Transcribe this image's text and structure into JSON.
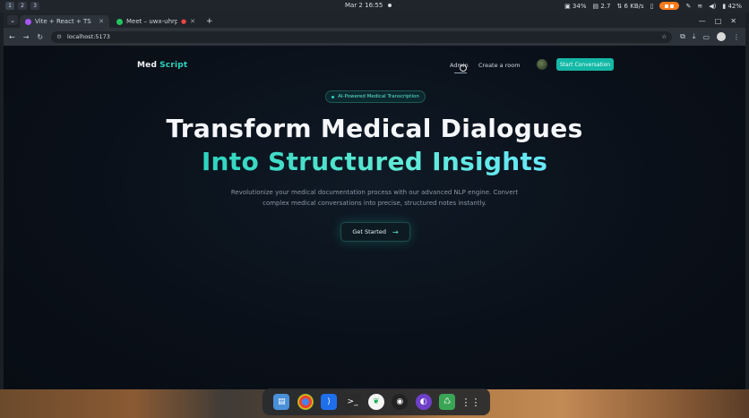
{
  "system_bar": {
    "workspaces": [
      "1",
      "2",
      "3"
    ],
    "datetime": "Mar 2  16:55",
    "cpu": "34%",
    "temp": "2.7",
    "net": "6 KB/s",
    "battery": "42%"
  },
  "browser": {
    "tabs": [
      {
        "title": "Vite + React + TS",
        "active": true,
        "favicon_color": "#a855f7"
      },
      {
        "title": "Meet – uwx-uhrp-...",
        "active": false,
        "favicon_color": "#22c55e"
      }
    ],
    "new_tab": "+",
    "url": "localhost:5173"
  },
  "page": {
    "logo_main": "Med",
    "logo_accent": "Script",
    "nav": {
      "admin": "Admin",
      "create_room": "Create a room",
      "cta": "Start Conversation"
    },
    "badge": "AI-Powered Medical Transcription",
    "headline_1": "Transform Medical Dialogues",
    "headline_2": "Into Structured Insights",
    "subtitle_1": "Revolutionize your medical documentation process with our advanced NLP engine. Convert",
    "subtitle_2": "complex medical conversations into precise, structured notes instantly.",
    "get_started": "Get Started",
    "accent_color": "#14b8a6"
  },
  "dock": {
    "apps": [
      "files-icon",
      "chrome-icon",
      "vscode-icon",
      "terminal-icon",
      "mongodb-icon",
      "obs-icon",
      "github-icon",
      "recycle-icon",
      "app-grid-icon"
    ]
  }
}
